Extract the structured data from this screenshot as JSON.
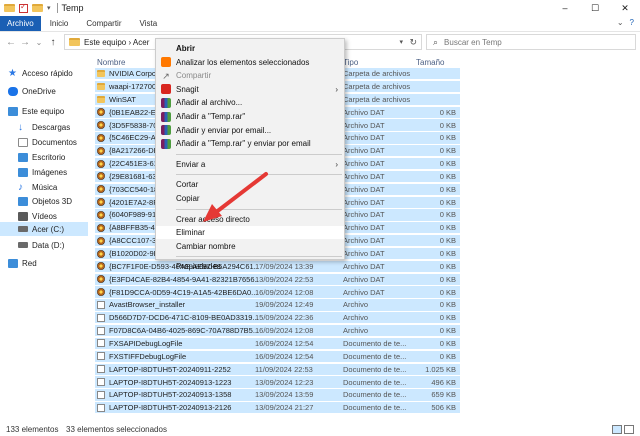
{
  "titlebar": {
    "title": "Temp",
    "controls": [
      "–",
      "☐",
      "✕"
    ]
  },
  "ribbon": {
    "tabs": [
      "Archivo",
      "Inicio",
      "Compartir",
      "Vista"
    ],
    "right_icons": [
      "⌄",
      "?"
    ]
  },
  "address": {
    "breadcrumb": "Este equipo  ›  Acer",
    "search_placeholder": "Buscar en Temp",
    "nav_back": "←",
    "nav_forward": "→",
    "nav_recent": "⌄",
    "nav_up": "↑",
    "refresh": "↻"
  },
  "sidebar": {
    "items": [
      {
        "label": "Acceso rápido",
        "icon": "star-icon",
        "color": "#2b78e4"
      },
      {
        "label": "OneDrive",
        "icon": "cloud-icon",
        "color": "#1a73e8"
      },
      {
        "label": "Este equipo",
        "icon": "computer-icon",
        "color": "#3c8dd9"
      },
      {
        "label": "Descargas",
        "icon": "download-icon",
        "color": "#2b78e4"
      },
      {
        "label": "Documentos",
        "icon": "documents-icon",
        "color": "#8a8a8a"
      },
      {
        "label": "Escritorio",
        "icon": "desktop-icon",
        "color": "#3c8dd9"
      },
      {
        "label": "Imágenes",
        "icon": "pictures-icon",
        "color": "#3c8dd9"
      },
      {
        "label": "Música",
        "icon": "music-icon",
        "color": "#2b78e4"
      },
      {
        "label": "Objetos 3D",
        "icon": "objects3d-icon",
        "color": "#3c8dd9"
      },
      {
        "label": "Vídeos",
        "icon": "videos-icon",
        "color": "#5a5a5a"
      },
      {
        "label": "Acer (C:)",
        "icon": "drive-icon",
        "color": "#6a6a6a"
      },
      {
        "label": "Data (D:)",
        "icon": "drive-icon",
        "color": "#6a6a6a"
      },
      {
        "label": "Red",
        "icon": "network-icon",
        "color": "#3c8dd9"
      }
    ]
  },
  "columns": {
    "name": "Nombre",
    "type": "Tipo",
    "size": "Tamaño"
  },
  "files": [
    {
      "name": "NVIDIA Corpo",
      "date": "",
      "type": "Carpeta de archivos",
      "size": "",
      "kind": "folder"
    },
    {
      "name": "waapi-172700",
      "date": "",
      "type": "Carpeta de archivos",
      "size": "",
      "kind": "folder"
    },
    {
      "name": "WinSAT",
      "date": "",
      "type": "Carpeta de archivos",
      "size": "",
      "kind": "folder"
    },
    {
      "name": "{0B1EAB22-E8",
      "date": "",
      "type": "Archivo DAT",
      "size": "0 KB",
      "kind": "dat"
    },
    {
      "name": "{3D5F5838-70C",
      "date": "",
      "type": "Archivo DAT",
      "size": "0 KB",
      "kind": "dat"
    },
    {
      "name": "{5C46EC29-A0",
      "date": "",
      "type": "Archivo DAT",
      "size": "0 KB",
      "kind": "dat"
    },
    {
      "name": "{8A217266-DB",
      "date": "",
      "type": "Archivo DAT",
      "size": "0 KB",
      "kind": "dat"
    },
    {
      "name": "{22C451E3-613",
      "date": "",
      "type": "Archivo DAT",
      "size": "0 KB",
      "kind": "dat"
    },
    {
      "name": "{29E81681-637",
      "date": "",
      "type": "Archivo DAT",
      "size": "0 KB",
      "kind": "dat"
    },
    {
      "name": "{703CC540-18",
      "date": "",
      "type": "Archivo DAT",
      "size": "0 KB",
      "kind": "dat"
    },
    {
      "name": "{4201E7A2-8F2",
      "date": "",
      "type": "Archivo DAT",
      "size": "0 KB",
      "kind": "dat"
    },
    {
      "name": "{6040F989-913",
      "date": "",
      "type": "Archivo DAT",
      "size": "0 KB",
      "kind": "dat"
    },
    {
      "name": "{A8BFFB35-43D",
      "date": "",
      "type": "Archivo DAT",
      "size": "0 KB",
      "kind": "dat"
    },
    {
      "name": "{A8CCC107-38",
      "date": "",
      "type": "Archivo DAT",
      "size": "0 KB",
      "kind": "dat"
    },
    {
      "name": "{B1020D02-9B",
      "date": "",
      "type": "Archivo DAT",
      "size": "0 KB",
      "kind": "dat"
    },
    {
      "name": "{BC7F1F0E-D593-40AE-AE87-B5A294C61...",
      "date": "17/09/2024 13:39",
      "type": "Archivo DAT",
      "size": "0 KB",
      "kind": "dat"
    },
    {
      "name": "{E3FD4CAE-82B4-4854-9A41-82321B7656...",
      "date": "13/09/2024 22:53",
      "type": "Archivo DAT",
      "size": "0 KB",
      "kind": "dat"
    },
    {
      "name": "{F81D9CCA-0D59-4C19-A1A5-42BE6DA0...",
      "date": "16/09/2024 12:08",
      "type": "Archivo DAT",
      "size": "0 KB",
      "kind": "dat"
    },
    {
      "name": "AvastBrowser_installer",
      "date": "19/09/2024 12:49",
      "type": "Archivo",
      "size": "0 KB",
      "kind": "doc"
    },
    {
      "name": "D566D7D7-DCD6-471C-8109-BE0AD3319...",
      "date": "15/09/2024 22:36",
      "type": "Archivo",
      "size": "0 KB",
      "kind": "doc"
    },
    {
      "name": "F07D8C6A-04B6-4025-869C-70A788D7B5...",
      "date": "16/09/2024 12:08",
      "type": "Archivo",
      "size": "0 KB",
      "kind": "doc"
    },
    {
      "name": "FXSAPIDebugLogFile",
      "date": "16/09/2024 12:54",
      "type": "Documento de te...",
      "size": "0 KB",
      "kind": "doc"
    },
    {
      "name": "FXSTIFFDebugLogFile",
      "date": "16/09/2024 12:54",
      "type": "Documento de te...",
      "size": "0 KB",
      "kind": "doc"
    },
    {
      "name": "LAPTOP-I8DTUH5T-20240911-2252",
      "date": "11/09/2024 22:53",
      "type": "Documento de te...",
      "size": "1.025 KB",
      "kind": "doc"
    },
    {
      "name": "LAPTOP-I8DTUH5T-20240913-1223",
      "date": "13/09/2024 12:23",
      "type": "Documento de te...",
      "size": "496 KB",
      "kind": "doc"
    },
    {
      "name": "LAPTOP-I8DTUH5T-20240913-1358",
      "date": "13/09/2024 13:59",
      "type": "Documento de te...",
      "size": "659 KB",
      "kind": "doc"
    },
    {
      "name": "LAPTOP-I8DTUH5T-20240913-2126",
      "date": "13/09/2024 21:27",
      "type": "Documento de te...",
      "size": "506 KB",
      "kind": "doc"
    }
  ],
  "context_menu": {
    "items": [
      {
        "label": "Abrir",
        "style": "bold",
        "icon": ""
      },
      {
        "label": "Analizar los elementos seleccionados",
        "icon": "avast-icon"
      },
      {
        "label": "Compartir",
        "style": "disabled",
        "icon": "share-icon"
      },
      {
        "label": "Snagit",
        "icon": "snagit-icon",
        "submenu": "›"
      },
      {
        "label": "Añadir al archivo...",
        "icon": "winrar-icon"
      },
      {
        "label": "Añadir a \"Temp.rar\"",
        "icon": "winrar-icon"
      },
      {
        "label": "Añadir y enviar por email...",
        "icon": "winrar-icon"
      },
      {
        "label": "Añadir a \"Temp.rar\" y enviar por email",
        "icon": "winrar-icon"
      },
      {
        "sep": true
      },
      {
        "label": "Enviar a",
        "submenu": "›"
      },
      {
        "sep": true
      },
      {
        "label": "Cortar"
      },
      {
        "label": "Copiar"
      },
      {
        "sep": true
      },
      {
        "label": "Crear acceso directo"
      },
      {
        "label": "Eliminar",
        "style": "hover"
      },
      {
        "label": "Cambiar nombre"
      },
      {
        "sep": true
      },
      {
        "label": "Propiedades"
      }
    ]
  },
  "status": {
    "count": "133 elementos",
    "selected": "33 elementos seleccionados"
  },
  "colors": {
    "selection": "#cce8ff",
    "accent": "#1a5fb4",
    "arrow": "#e53935"
  }
}
